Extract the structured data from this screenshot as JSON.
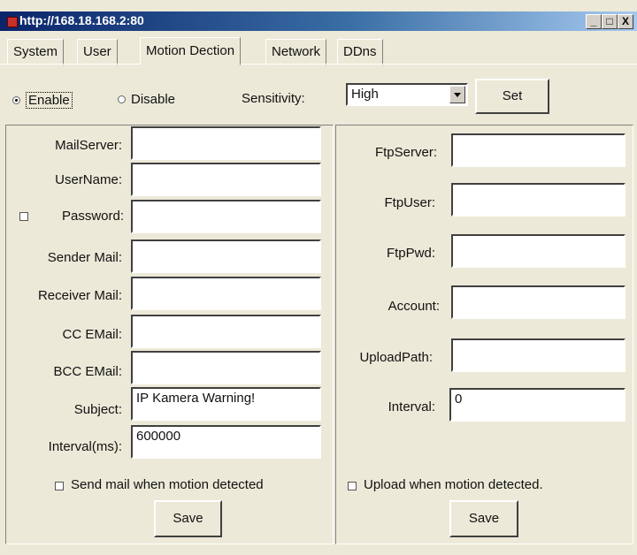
{
  "window": {
    "title": "http://168.18.168.2:80",
    "min_glyph": "_",
    "max_glyph": "□",
    "close_glyph": "X"
  },
  "tabs": [
    "System",
    "User",
    "Motion Dection",
    "Network",
    "DDns"
  ],
  "active_tab": "Motion Dection",
  "mode": {
    "enable_label": "Enable",
    "disable_label": "Disable",
    "selected": "Enable"
  },
  "sensitivity": {
    "label": "Sensitivity:",
    "value": "High",
    "set_label": "Set"
  },
  "mail": {
    "mail_server_label": "MailServer:",
    "mail_server_value": "",
    "username_label": "UserName:",
    "username_value": "",
    "password_label": "Password:",
    "password_value": "",
    "password_checked": false,
    "sender_label": "Sender Mail:",
    "sender_value": "",
    "receiver_label": "Receiver Mail:",
    "receiver_value": "",
    "cc_label": "CC EMail:",
    "cc_value": "",
    "bcc_label": "BCC EMail:",
    "bcc_value": "",
    "subject_label": "Subject:",
    "subject_value": "IP Kamera Warning!",
    "interval_label": "Interval(ms):",
    "interval_value": "600000",
    "send_checkbox_label": "Send mail when motion detected",
    "send_checked": false,
    "save_label": "Save"
  },
  "ftp": {
    "server_label": "FtpServer:",
    "server_value": "",
    "user_label": "FtpUser:",
    "user_value": "",
    "pwd_label": "FtpPwd:",
    "pwd_value": "",
    "account_label": "Account:",
    "account_value": "",
    "path_label": "UploadPath:",
    "path_value": "",
    "interval_label": "Interval:",
    "interval_value": "0",
    "upload_checkbox_label": "Upload when motion detected.",
    "upload_checked": false,
    "save_label": "Save"
  }
}
